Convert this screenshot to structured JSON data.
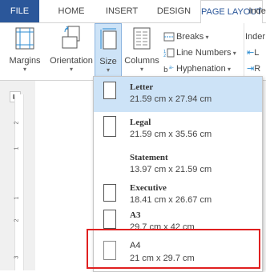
{
  "tabs": [
    "FILE",
    "HOME",
    "INSERT",
    "DESIGN",
    "PAGE LAYOUT",
    "Inder"
  ],
  "ribbon": {
    "margins": "Margins",
    "orientation": "Orientation",
    "size": "Size",
    "columns": "Columns",
    "breaks": "Breaks",
    "line_numbers": "Line Numbers",
    "hyphenation": "Hyphenation",
    "indent_left": "L",
    "indent_right": "R"
  },
  "ruler": {
    "numbers": [
      "2",
      "1",
      "1",
      "2",
      "3"
    ]
  },
  "size_menu": {
    "items": [
      {
        "name": "Letter",
        "dims": "21.59 cm x 27.94 cm",
        "selected": true
      },
      {
        "name": "Legal",
        "dims": "21.59 cm x 35.56 cm",
        "selected": false
      },
      {
        "name": "Statement",
        "dims": "13.97 cm x 21.59 cm",
        "selected": false
      },
      {
        "name": "Executive",
        "dims": "18.41 cm x 26.67 cm",
        "selected": false
      },
      {
        "name": "A3",
        "dims": "29.7 cm x 42 cm",
        "selected": false
      },
      {
        "name": "A4",
        "dims": "21 cm x 29.7 cm",
        "selected": false
      }
    ]
  },
  "colors": {
    "file_tab": "#2b579a",
    "selection": "#cde3f7",
    "highlight_box": "#e02020"
  },
  "icons": [
    "margins-icon",
    "orientation-icon",
    "size-icon",
    "columns-icon",
    "breaks-icon",
    "line-numbers-icon",
    "hyphenation-icon"
  ]
}
